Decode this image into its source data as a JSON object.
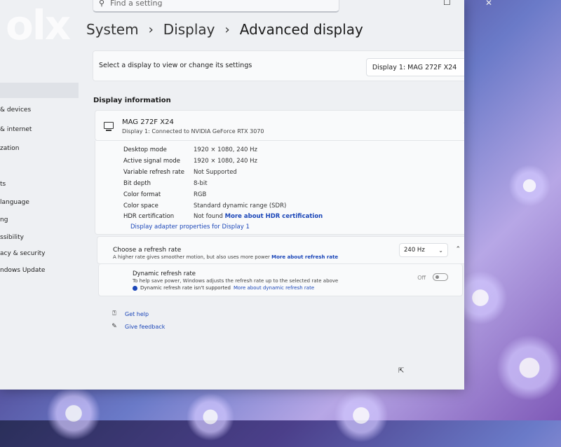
{
  "watermark": "olx",
  "search": {
    "placeholder": "Find a setting"
  },
  "window_controls": {
    "minimize": "—",
    "maximize": "☐",
    "close": "✕"
  },
  "sidebar": {
    "items": [
      {
        "label": "& devices"
      },
      {
        "label": "& internet"
      },
      {
        "label": "zation"
      },
      {
        "label": "ts"
      },
      {
        "label": "language"
      },
      {
        "label": "ng"
      },
      {
        "label": "ssibility"
      },
      {
        "label": "acy & security"
      },
      {
        "label": "ndows Update"
      }
    ]
  },
  "breadcrumb": {
    "items": [
      "System",
      "Display",
      "Advanced display"
    ],
    "separator": "›"
  },
  "display_select": {
    "label": "Select a display to view or change its settings",
    "value": "Display 1: MAG 272F X24"
  },
  "display_info": {
    "section_title": "Display information",
    "monitor_name": "MAG 272F X24",
    "monitor_sub": "Display 1: Connected to NVIDIA GeForce RTX 3070",
    "rows": [
      {
        "label": "Desktop mode",
        "value": "1920 × 1080, 240 Hz"
      },
      {
        "label": "Active signal mode",
        "value": "1920 × 1080, 240 Hz"
      },
      {
        "label": "Variable refresh rate",
        "value": "Not Supported"
      },
      {
        "label": "Bit depth",
        "value": "8-bit"
      },
      {
        "label": "Color format",
        "value": "RGB"
      },
      {
        "label": "Color space",
        "value": "Standard dynamic range (SDR)"
      },
      {
        "label": "HDR certification",
        "value": "Not found",
        "link": "More about HDR certification"
      }
    ],
    "adapter_link": "Display adapter properties for Display 1"
  },
  "refresh_rate": {
    "title": "Choose a refresh rate",
    "subtitle": "A higher rate gives smoother motion, but also uses more power",
    "link": "More about refresh rate",
    "value": "240 Hz"
  },
  "dynamic_refresh": {
    "title": "Dynamic refresh rate",
    "subtitle": "To help save power, Windows adjusts the refresh rate up to the selected rate above",
    "warning": "Dynamic refresh rate isn't supported",
    "link": "More about dynamic refresh rate",
    "toggle_label": "Off"
  },
  "help": {
    "get_help": "Get help",
    "give_feedback": "Give feedback"
  }
}
